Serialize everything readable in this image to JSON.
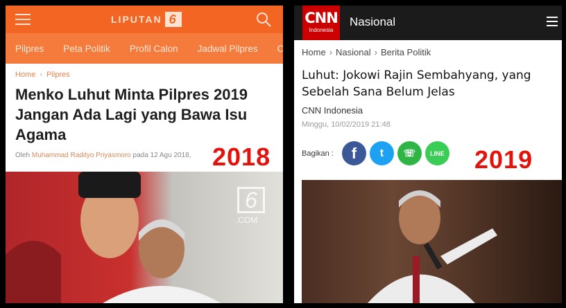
{
  "left": {
    "brand": "LIPUTAN",
    "brand_mark": "6",
    "nav": [
      "Pilpres",
      "Peta Politik",
      "Profil Calon",
      "Jadwal Pilpres",
      "Ce"
    ],
    "breadcrumb": [
      "Home",
      "Pilpres"
    ],
    "title": "Menko Luhut Minta Pilpres 2019 Jangan Ada Lagi yang Bawa Isu Agama",
    "byline_prefix": "Oleh ",
    "author": "Muhammad Radityo Priyasmoro",
    "byline_suffix": " pada 12 Agu 2018,",
    "year_label": "2018",
    "watermark": "6",
    "watermark_domain": ".COM"
  },
  "right": {
    "logo_main": "CNN",
    "logo_sub": "Indonesia",
    "section": "Nasional",
    "breadcrumb": [
      "Home",
      "Nasional",
      "Berita Politik"
    ],
    "title": "Luhut: Jokowi Rajin Sembahyang, yang Sebelah Sana Belum Jelas",
    "source": "CNN Indonesia",
    "date": "Minggu, 10/02/2019 21:48",
    "share_label": "Bagikan :",
    "share_icons": [
      "facebook-icon",
      "twitter-icon",
      "whatsapp-icon",
      "line-icon"
    ],
    "share_glyphs": [
      "f",
      "t",
      "☏",
      "LINE"
    ],
    "year_label": "2019"
  },
  "colors": {
    "liputan_orange": "#f26522",
    "cnn_red": "#cc0000",
    "year_red": "#e3120b"
  }
}
